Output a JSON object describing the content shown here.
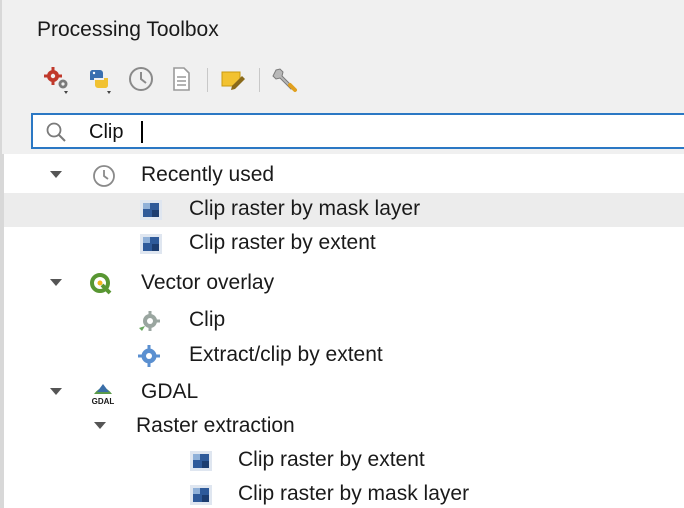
{
  "panel": {
    "title": "Processing Toolbox"
  },
  "toolbar": {
    "items": [
      {
        "icon": "gear-models-icon"
      },
      {
        "icon": "python-scripts-icon"
      },
      {
        "icon": "history-icon"
      },
      {
        "icon": "results-viewer-icon"
      },
      {
        "icon": "edit-features-in-place-icon"
      },
      {
        "icon": "options-wrench-icon"
      }
    ]
  },
  "search": {
    "value": "Clip",
    "placeholder": ""
  },
  "tree": {
    "recently_used": {
      "label": "Recently used",
      "items": [
        "Clip raster by mask layer",
        "Clip raster by extent"
      ]
    },
    "vector_overlay": {
      "label": "Vector overlay",
      "items": [
        "Clip",
        "Extract/clip by extent"
      ]
    },
    "gdal": {
      "label": "GDAL",
      "raster_extraction": {
        "label": "Raster extraction",
        "items": [
          "Clip raster by extent",
          "Clip raster by mask layer"
        ]
      }
    }
  },
  "colors": {
    "focus_border": "#2b78c4",
    "selected_row": "#ececec",
    "qgis_green": "#589632",
    "raster_blue": "#2e5a9a",
    "gear_red": "#c0392b"
  }
}
